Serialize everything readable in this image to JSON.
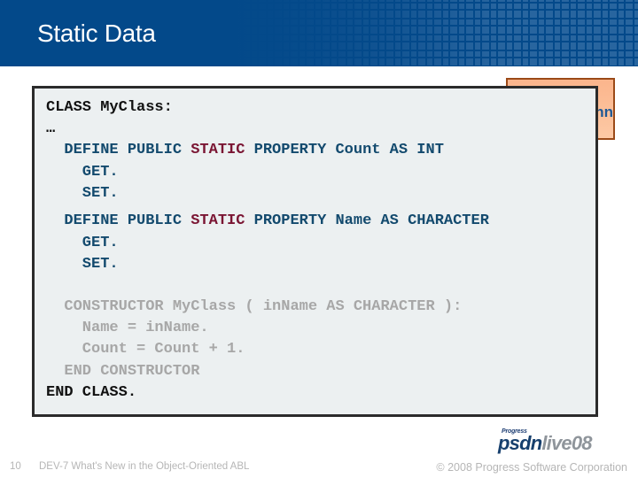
{
  "slide": {
    "title": "Static Data",
    "slide_number": "10",
    "footer_text": "DEV-7 What's New in the Object-Oriented ABL",
    "copyright": "© 2008 Progress Software Corporation"
  },
  "callout": {
    "visible_text": "nn"
  },
  "logo": {
    "small_text": "Progress",
    "brand_primary": "psdn",
    "brand_secondary": "live08"
  },
  "colors": {
    "header_bg": "#03498a",
    "code_bg": "#ecf0f1",
    "keyword_blue": "#134a6e",
    "static_red": "#7a1533",
    "dimmed_gray": "#a7a7a7",
    "callout_bg": "#fbb58c",
    "callout_border": "#9b4a18"
  },
  "code": {
    "l1": "CLASS MyClass:",
    "l2": "…",
    "l3a": "  DEFINE PUBLIC ",
    "l3b": "STATIC",
    "l3c": " PROPERTY Count AS INT",
    "l4": "    GET.",
    "l5": "    SET.",
    "l6a": "  DEFINE PUBLIC ",
    "l6b": "STATIC",
    "l6c": " PROPERTY Name AS CHARACTER",
    "l7": "    GET.",
    "l8": "    SET.",
    "l9": "  CONSTRUCTOR MyClass ( inName AS CHARACTER ):",
    "l10": "    Name = inName.",
    "l11": "    Count = Count + 1.",
    "l12": "  END CONSTRUCTOR",
    "l13": "END CLASS."
  }
}
